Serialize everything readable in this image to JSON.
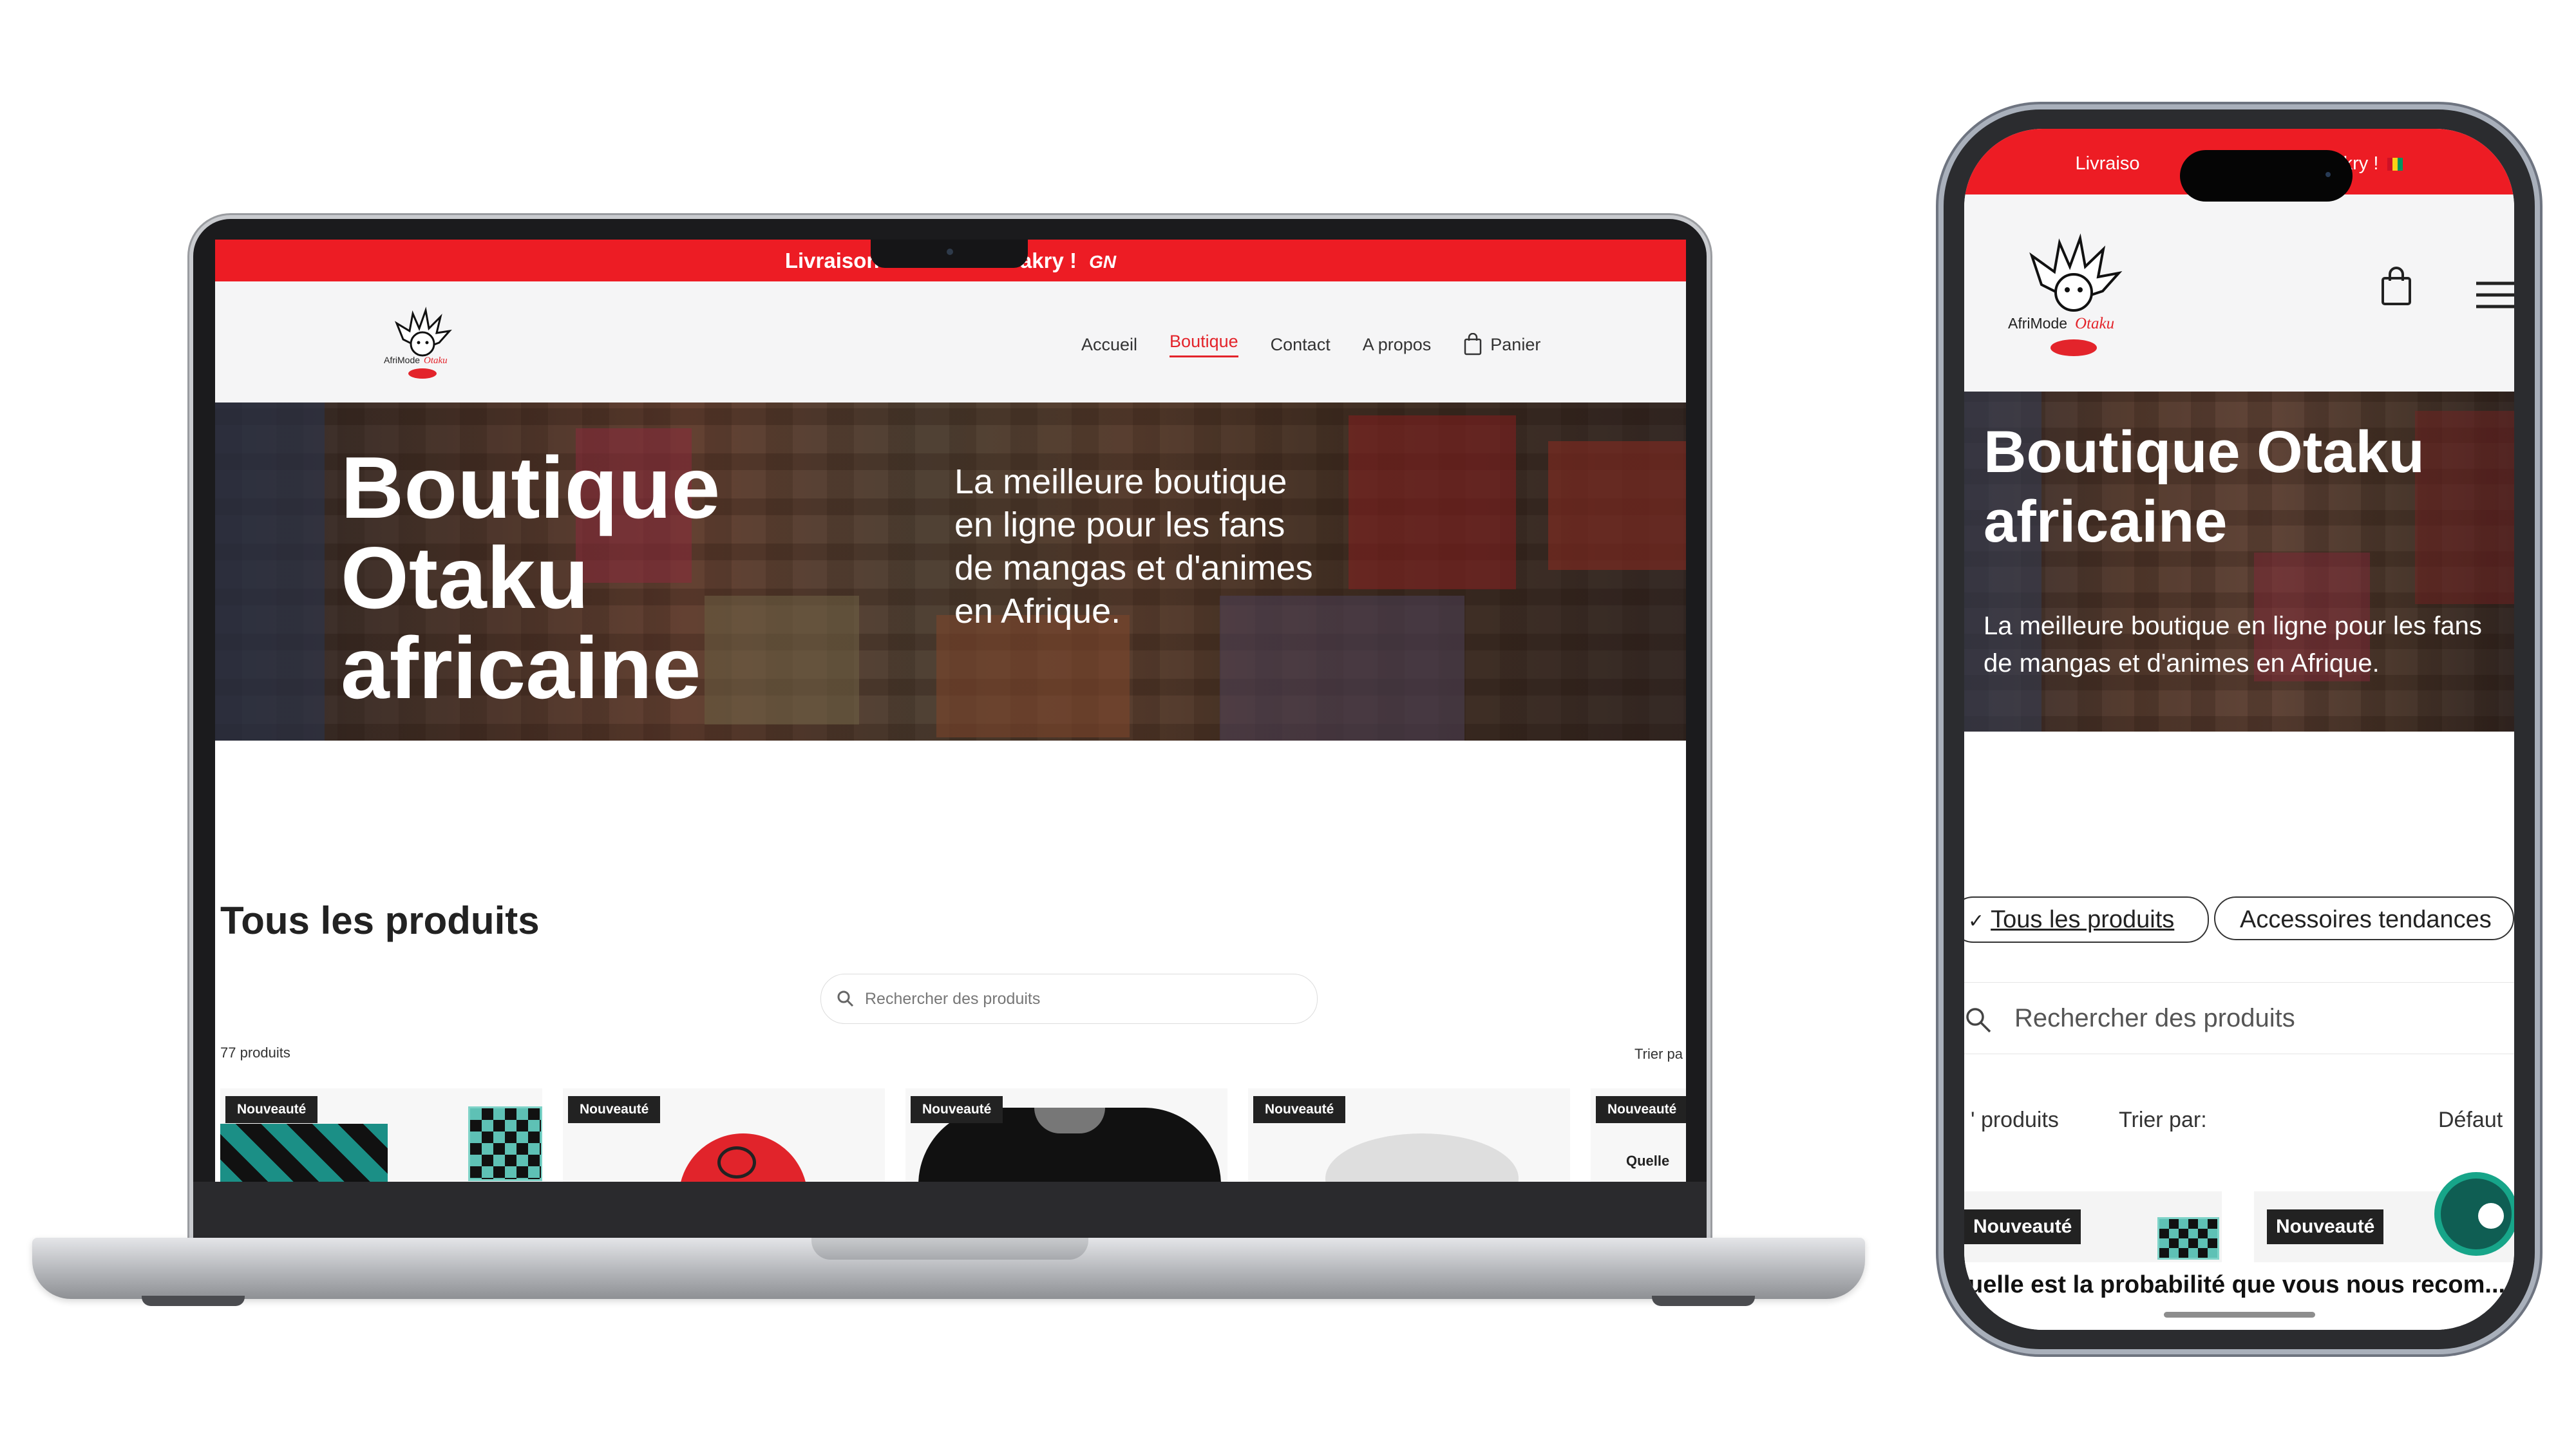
{
  "colors": {
    "brand_red": "#ed1c24",
    "accent_red": "#e3242b",
    "badge_dark": "#222222",
    "chat_green": "#17a589"
  },
  "laptop": {
    "banner": {
      "text": "Livraison",
      "text_end": "akry !",
      "flag_text": "GN"
    },
    "nav": {
      "home": "Accueil",
      "shop": "Boutique",
      "contact": "Contact",
      "about": "A propos",
      "cart": "Panier"
    },
    "hero": {
      "title": "Boutique Otaku africaine",
      "subtitle": "La meilleure boutique en ligne pour les fans de mangas et d'animes en Afrique."
    },
    "section_title": "Tous les produits",
    "search_placeholder": "Rechercher des produits",
    "count": "77 produits",
    "sort_label": "Trier pa",
    "cards": [
      {
        "badge": "Nouveauté"
      },
      {
        "badge": "Nouveauté"
      },
      {
        "badge": "Nouveauté"
      },
      {
        "badge": "Nouveauté"
      },
      {
        "badge": "Nouveauté",
        "extra": "Quelle"
      }
    ]
  },
  "phone": {
    "banner": {
      "left": "Livraiso",
      "right": "kry !"
    },
    "logo_text": {
      "part1": "AfriMode",
      "part2": "Otaku"
    },
    "hero": {
      "title": "Boutique Otaku africaine",
      "subtitle": "La meilleure boutique en ligne pour les fans de mangas et d'animes en Afrique."
    },
    "chips": [
      {
        "label": "Tous les produits"
      },
      {
        "label": "Accessoires tendances"
      }
    ],
    "search_placeholder": "Rechercher des produits",
    "count": "' produits",
    "sort_label": "Trier par:",
    "sort_value": "Défaut",
    "cards": [
      {
        "badge": "Nouveauté"
      },
      {
        "badge": "Nouveauté"
      }
    ],
    "survey": "uelle est la probabilité que vous nous recom..."
  }
}
